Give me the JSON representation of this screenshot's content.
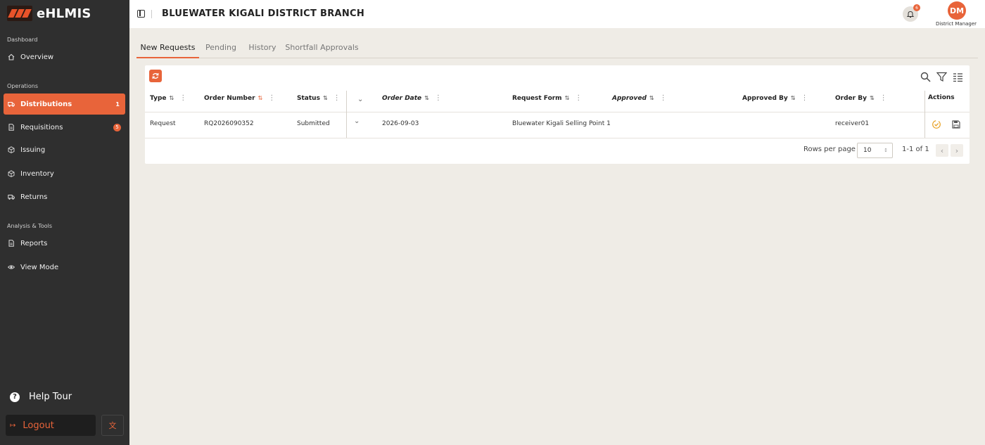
{
  "app": {
    "name": "eHLMIS"
  },
  "sidebar": {
    "sections": [
      {
        "label": "Dashboard"
      },
      {
        "label": "Operations"
      },
      {
        "label": "Analysis & Tools"
      }
    ],
    "items": [
      {
        "label": "Overview",
        "icon": "home-icon"
      },
      {
        "label": "Distributions",
        "icon": "truck-icon",
        "count": "1",
        "active": true
      },
      {
        "label": "Requisitions",
        "icon": "document-icon",
        "badge": "5"
      },
      {
        "label": "Issuing",
        "icon": "box-icon"
      },
      {
        "label": "Inventory",
        "icon": "box-icon"
      },
      {
        "label": "Returns",
        "icon": "truck-icon"
      },
      {
        "label": "Reports",
        "icon": "document-icon"
      },
      {
        "label": "View Mode",
        "icon": "eye-icon"
      }
    ],
    "help_tour": "Help Tour",
    "logout": "Logout"
  },
  "header": {
    "title": "BLUEWATER KIGALI DISTRICT BRANCH",
    "notifications": "6",
    "avatar_initials": "DM",
    "user_role": "District Manager"
  },
  "tabs": [
    {
      "label": "New Requests",
      "active": true
    },
    {
      "label": "Pending"
    },
    {
      "label": "History"
    },
    {
      "label": "Shortfall Approvals"
    }
  ],
  "table": {
    "columns": [
      {
        "label": "Type"
      },
      {
        "label": "Order Number"
      },
      {
        "label": "Status"
      },
      {
        "label": "Order Date"
      },
      {
        "label": "Request Form"
      },
      {
        "label": "Approved"
      },
      {
        "label": "Approved By"
      },
      {
        "label": "Order By"
      },
      {
        "label": "Actions"
      }
    ],
    "rows": [
      {
        "type": "Request",
        "order_number": "RQ2026090352",
        "status": "Submitted",
        "order_date": "2026-09-03",
        "request_form": "Bluewater Kigali Selling Point 1",
        "approved": "",
        "approved_by": "",
        "order_by": "receiver01"
      }
    ],
    "pagination": {
      "rows_per_page_label": "Rows per page",
      "rows_per_page": "10",
      "range": "1-1 of 1"
    }
  },
  "colors": {
    "accent": "#e8643a",
    "sidebar_bg": "#2f2f2f",
    "page_bg": "#efece6"
  }
}
